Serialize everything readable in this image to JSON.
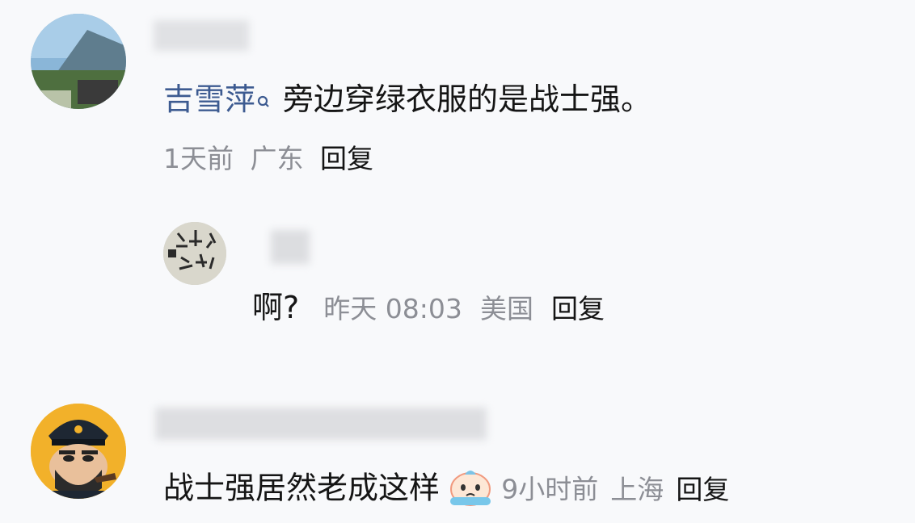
{
  "comments": [
    {
      "mention": "吉雪萍",
      "text": "旁边穿绿衣服的是战士强。",
      "time": "1天前",
      "location": "广东",
      "reply_label": "回复"
    },
    {
      "text": "啊?",
      "time": "昨天 08:03",
      "location": "美国",
      "reply_label": "回复"
    },
    {
      "text": "战士强居然老成这样",
      "time": "9小时前",
      "location": "上海",
      "reply_label": "回复"
    }
  ],
  "colors": {
    "mention": "#3d5b91",
    "text": "#151515",
    "meta": "#8c8e95",
    "background": "#f8f9fb"
  },
  "icons": [
    "user-avatar",
    "user-avatar",
    "captain-avatar",
    "search-icon",
    "crying-emoji-icon"
  ]
}
